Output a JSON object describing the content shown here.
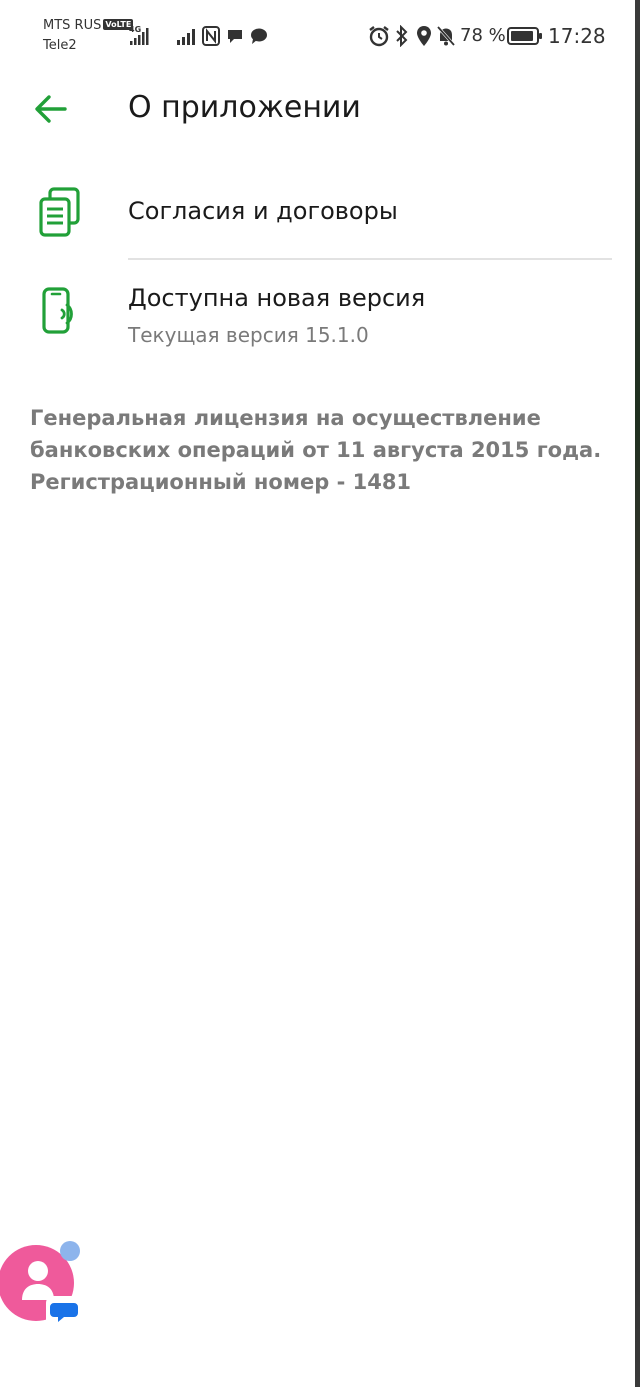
{
  "status_bar": {
    "carrier_primary": "MTS RUS",
    "volte_badge": "VoLTE",
    "carrier_secondary": "Tele2",
    "network_type": "4G",
    "battery_percent": "78 %",
    "time": "17:28",
    "icons": [
      "signal-4g-icon",
      "signal-icon",
      "nfc-icon",
      "chat-bubble-icon",
      "message-icon",
      "alarm-icon",
      "bluetooth-icon",
      "location-icon",
      "mute-icon",
      "battery-icon"
    ]
  },
  "header": {
    "title": "О приложении",
    "back_icon": "arrow-left-icon"
  },
  "items": [
    {
      "title": "Согласия и договоры",
      "icon": "documents-icon"
    },
    {
      "title": "Доступна новая версия",
      "subtitle": "Текущая версия 15.1.0",
      "icon": "phone-update-icon"
    }
  ],
  "license": {
    "lines": [
      "Генеральная лицензия на осуществление",
      "банковских операций от 11 августа 2015 года.",
      "Регистрационный номер - 1481"
    ]
  },
  "colors": {
    "accent": "#21A038",
    "text_primary": "#1a1a1a",
    "text_secondary": "#7a7a7a",
    "divider": "#e2e2e2",
    "assistant_pink": "#ef5a9b",
    "assistant_blue": "#1a73e8"
  }
}
